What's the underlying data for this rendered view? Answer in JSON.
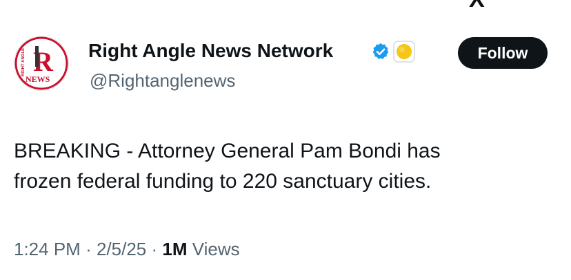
{
  "header": {
    "partial_glyph": "X"
  },
  "author": {
    "avatar_text_top": "RIGHT ANGLE",
    "avatar_letter": "R",
    "avatar_text_bottom": "NEWS",
    "name": "Right Angle News Network",
    "handle": "@Rightanglenews",
    "verified_icon": "verified-badge-icon",
    "affiliate_icon": "yellow-circle-affiliate-icon"
  },
  "actions": {
    "follow_label": "Follow"
  },
  "tweet": {
    "text_lines": [
      "BREAKING - Attorney General Pam Bondi has",
      "frozen federal funding to 220 sanctuary cities."
    ]
  },
  "meta": {
    "time": "1:24 PM",
    "separator": "·",
    "date": "2/5/25",
    "views_count": "1M",
    "views_label": "Views"
  },
  "colors": {
    "text_primary": "#0f1419",
    "text_secondary": "#536471",
    "verified_blue": "#1d9bf0",
    "affiliate_yellow": "#f5c518",
    "logo_red": "#c8102e",
    "follow_bg": "#0f1419"
  }
}
